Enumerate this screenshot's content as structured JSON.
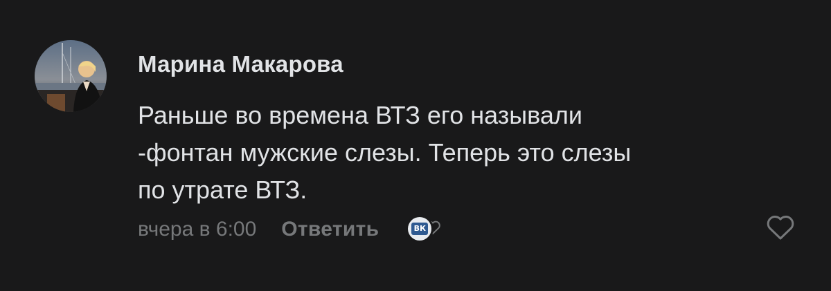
{
  "comment": {
    "author": "Марина Макарова",
    "text": "Раньше во времена ВТЗ его называли\n-фонтан мужские слезы. Теперь это слезы\nпо утрате ВТЗ.",
    "timestamp": "вчера в 6:00",
    "reply_label": "Ответить",
    "reaction_badge_text": "ВК"
  },
  "icons": {
    "avatar": "avatar-photo",
    "reaction": "heart-icon",
    "like": "heart-outline-icon"
  },
  "colors": {
    "background": "#19191a",
    "text_primary": "#e1e3e6",
    "text_secondary": "#76787a"
  }
}
